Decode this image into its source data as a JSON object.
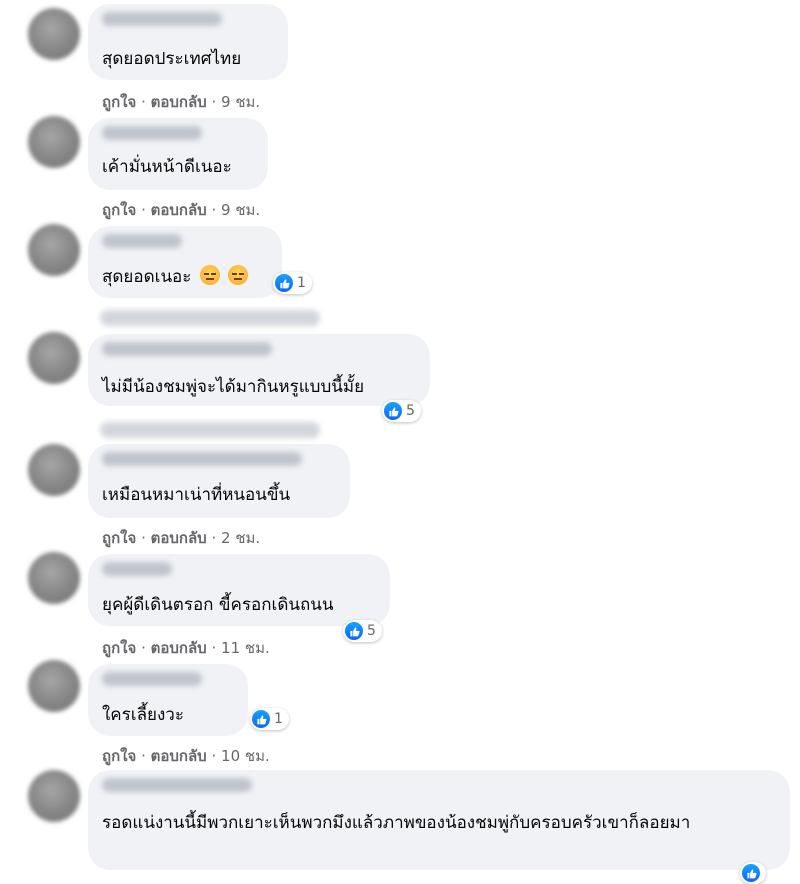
{
  "comments": [
    {
      "text": "สุดยอดประเทศไทย",
      "meta": {
        "like": "ถูกใจ",
        "reply": "ตอบกลับ",
        "time": "9 ชม."
      }
    },
    {
      "text": "เค้ามั่นหน้าดีเนอะ",
      "meta": {
        "like": "ถูกใจ",
        "reply": "ตอบกลับ",
        "time": "9 ชม."
      }
    },
    {
      "text": "สุดยอดเนอะ",
      "emoji": [
        "expressionless-face-icon",
        "expressionless-face-icon"
      ],
      "reaction_count": "1"
    },
    {
      "text": "ไม่มีน้องชมพู่จะได้มากินหรูแบบนี้มั้ย",
      "reaction_count": "5"
    },
    {
      "text": "เหมือนหมาเน่าที่หนอนขึ้น",
      "meta": {
        "like": "ถูกใจ",
        "reply": "ตอบกลับ",
        "time": "2 ชม."
      }
    },
    {
      "text": "ยุคผู้ดีเดินตรอก ขี้ครอกเดินถนน",
      "reaction_count": "5",
      "meta": {
        "like": "ถูกใจ",
        "reply": "ตอบกลับ",
        "time": "11 ชม."
      }
    },
    {
      "text": "ใครเลี้ยงวะ",
      "reaction_count": "1",
      "meta": {
        "like": "ถูกใจ",
        "reply": "ตอบกลับ",
        "time": "10 ชม."
      }
    },
    {
      "text": "รอดแน่งานนี้มีพวกเยาะเห็นพวกมึงแล้วภาพของน้องชมพู่กับครอบครัวเขาก็ลอยมา"
    }
  ],
  "separator": "·",
  "colors": {
    "bubble": "#f0f2f5",
    "meta": "#65676b",
    "like_blue": "#0866ff"
  },
  "icons": {
    "reaction": "like-thumb-icon"
  }
}
